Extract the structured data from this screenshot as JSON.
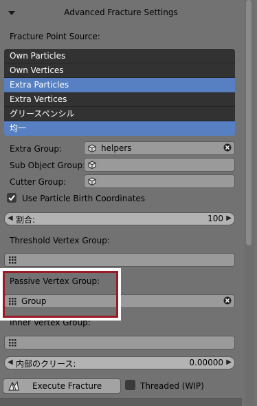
{
  "panel": {
    "title": "Advanced Fracture Settings"
  },
  "fracture_point_source": {
    "label": "Fracture Point Source:",
    "items": [
      {
        "label": "Own Particles",
        "selected": false
      },
      {
        "label": "Own Vertices",
        "selected": false
      },
      {
        "label": "Extra Particles",
        "selected": true
      },
      {
        "label": "Extra Vertices",
        "selected": false
      },
      {
        "label": "グリースペンシル",
        "selected": false
      },
      {
        "label": "均一",
        "selected": true
      }
    ]
  },
  "extra_group": {
    "label": "Extra Group:",
    "value": "helpers",
    "icon": "cube-icon"
  },
  "sub_object_group": {
    "label": "Sub Object Group:",
    "value": ""
  },
  "cutter_group": {
    "label": "Cutter Group:",
    "value": ""
  },
  "use_particle_birth": {
    "label": "Use Particle Birth Coordinates",
    "checked": true
  },
  "ratio": {
    "label": "割合:",
    "value": "100"
  },
  "threshold_vertex_group": {
    "label": "Threshold Vertex Group:",
    "value": ""
  },
  "passive_vertex_group": {
    "label": "Passive Vertex Group:",
    "value": "Group"
  },
  "inner_vertex_group": {
    "label": "Inner Vertex Group:",
    "value": ""
  },
  "inner_crease": {
    "label": "内部のクリース:",
    "value": "0.00000"
  },
  "execute_button": {
    "label": "Execute Fracture"
  },
  "threaded": {
    "label": "Threaded (WIP)",
    "checked": false
  },
  "colors": {
    "selected": "#5680c2",
    "list_bg": "#323232",
    "highlight": "#9a1b26"
  }
}
